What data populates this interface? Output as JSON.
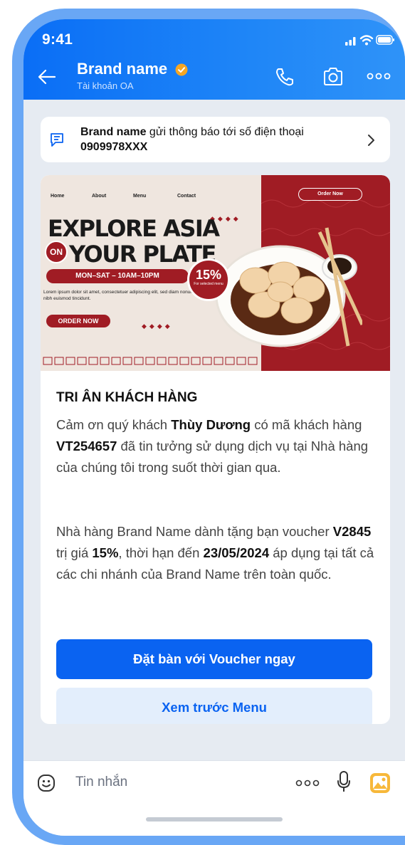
{
  "status_bar": {
    "time": "9:41"
  },
  "header": {
    "title": "Brand name",
    "subtitle": "Tài khoản OA"
  },
  "notice": {
    "brand": "Brand name",
    "text": " gửi thông báo tới số điện thoại",
    "phone": "0909978XXX"
  },
  "banner": {
    "nav": [
      "Home",
      "About",
      "Menu",
      "Contact"
    ],
    "order_now_top": "Order Now",
    "title_line1": "EXPLORE ASIA",
    "on": "ON",
    "title_line2": "YOUR PLATE",
    "hours": "MON–SAT – 10AM–10PM",
    "lorem": "Lorem ipsum dolor sit amet, consectetuer adipiscing elit, sed diam nonummy nibh euismod tincidunt.",
    "order_now": "ORDER NOW",
    "discount": "15%",
    "discount_sub": "For selected menu"
  },
  "message": {
    "title": "TRI ÂN KHÁCH HÀNG",
    "p1_a": "Cảm ơn quý khách ",
    "p1_name": "Thùy Dương",
    "p1_b": " có mã khách hàng ",
    "p1_code": "VT254657",
    "p1_c": " đã tin tưởng sử dụng dịch vụ tại Nhà hàng của chúng tôi trong suốt thời gian qua.",
    "p2_a": "Nhà hàng Brand Name dành tặng bạn voucher ",
    "p2_voucher": "V2845",
    "p2_b": " trị giá ",
    "p2_value": "15%",
    "p2_c": ", thời hạn đến ",
    "p2_date": "23/05/2024",
    "p2_d": " áp dụng tại tất cả các chi nhánh của Brand Name trên toàn quốc."
  },
  "buttons": {
    "primary": "Đặt bàn với Voucher ngay",
    "secondary": "Xem trước Menu"
  },
  "input": {
    "placeholder": "Tin nhắn"
  },
  "colors": {
    "header_blue": "#0a6ef6",
    "primary_button": "#0a63f1",
    "secondary_button_bg": "#e3eefc",
    "banner_red": "#a01c24",
    "verified_badge": "#f5a623"
  }
}
